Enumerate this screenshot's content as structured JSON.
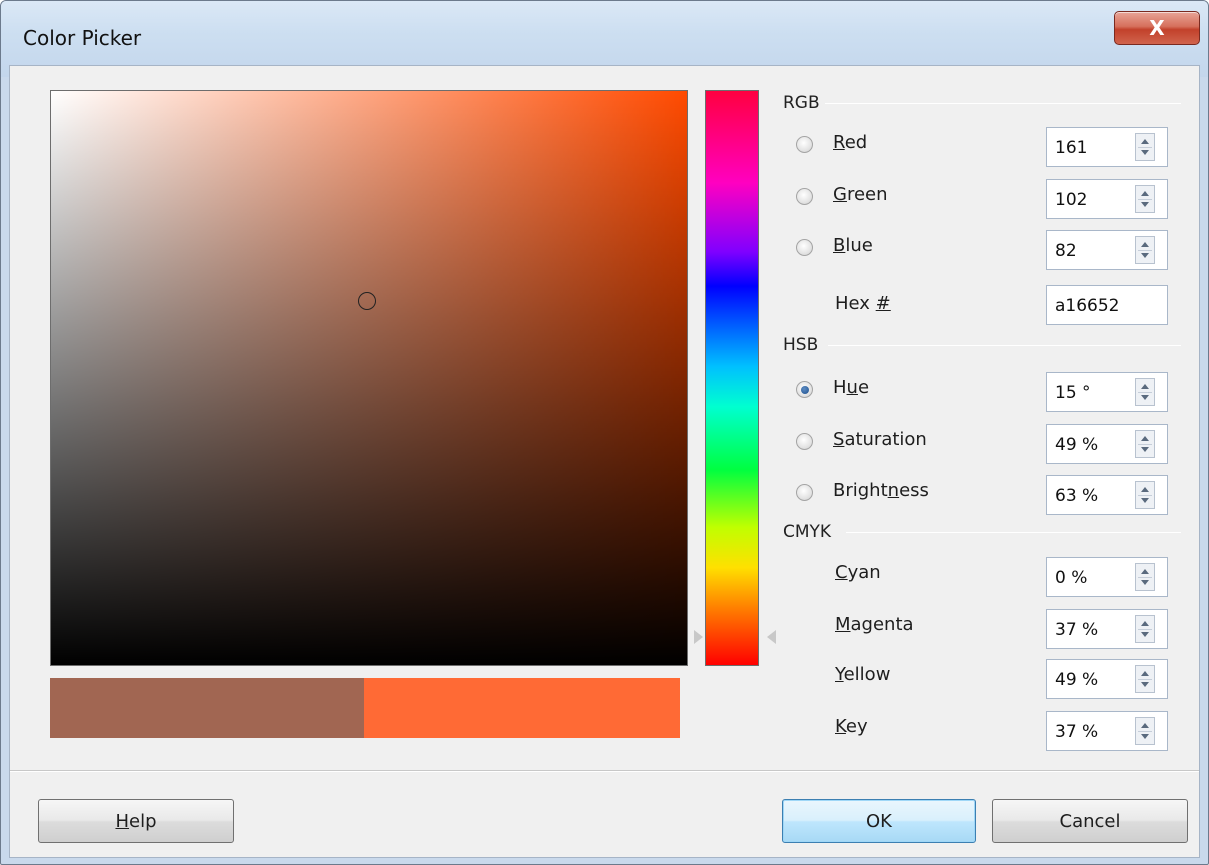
{
  "window": {
    "title": "Color Picker",
    "close_label": "X"
  },
  "colors": {
    "current": "#a16652",
    "new": "#ff6a35",
    "area_hue": "#ff4a00"
  },
  "rgb": {
    "group_label": "RGB",
    "red": {
      "label": "Red",
      "accel": "R",
      "rest": "ed",
      "value": "161",
      "checked": false
    },
    "green": {
      "label": "Green",
      "accel": "G",
      "rest": "reen",
      "value": "102",
      "checked": false
    },
    "blue": {
      "label": "Blue",
      "accel": "B",
      "rest": "lue",
      "value": "82",
      "checked": false
    },
    "hex": {
      "label": "Hex #",
      "pre": "Hex ",
      "accel": "#",
      "value": "a16652"
    }
  },
  "hsb": {
    "group_label": "HSB",
    "hue": {
      "label": "Hue",
      "pre": "H",
      "accel": "u",
      "post": "e",
      "value": "15 °",
      "checked": true
    },
    "saturation": {
      "label": "Saturation",
      "accel": "S",
      "rest": "aturation",
      "value": "49 %",
      "checked": false
    },
    "brightness": {
      "label": "Brightness",
      "pre": "Bright",
      "accel": "n",
      "post": "ess",
      "value": "63 %",
      "checked": false
    }
  },
  "cmyk": {
    "group_label": "CMYK",
    "cyan": {
      "label": "Cyan",
      "accel": "C",
      "rest": "yan",
      "value": "0 %"
    },
    "magenta": {
      "label": "Magenta",
      "accel": "M",
      "rest": "agenta",
      "value": "37 %"
    },
    "yellow": {
      "label": "Yellow",
      "accel": "Y",
      "rest": "ellow",
      "value": "49 %"
    },
    "key": {
      "label": "Key",
      "accel": "K",
      "rest": "ey",
      "value": "37 %"
    }
  },
  "buttons": {
    "help": {
      "accel": "H",
      "rest": "elp"
    },
    "ok": "OK",
    "cancel": "Cancel"
  }
}
